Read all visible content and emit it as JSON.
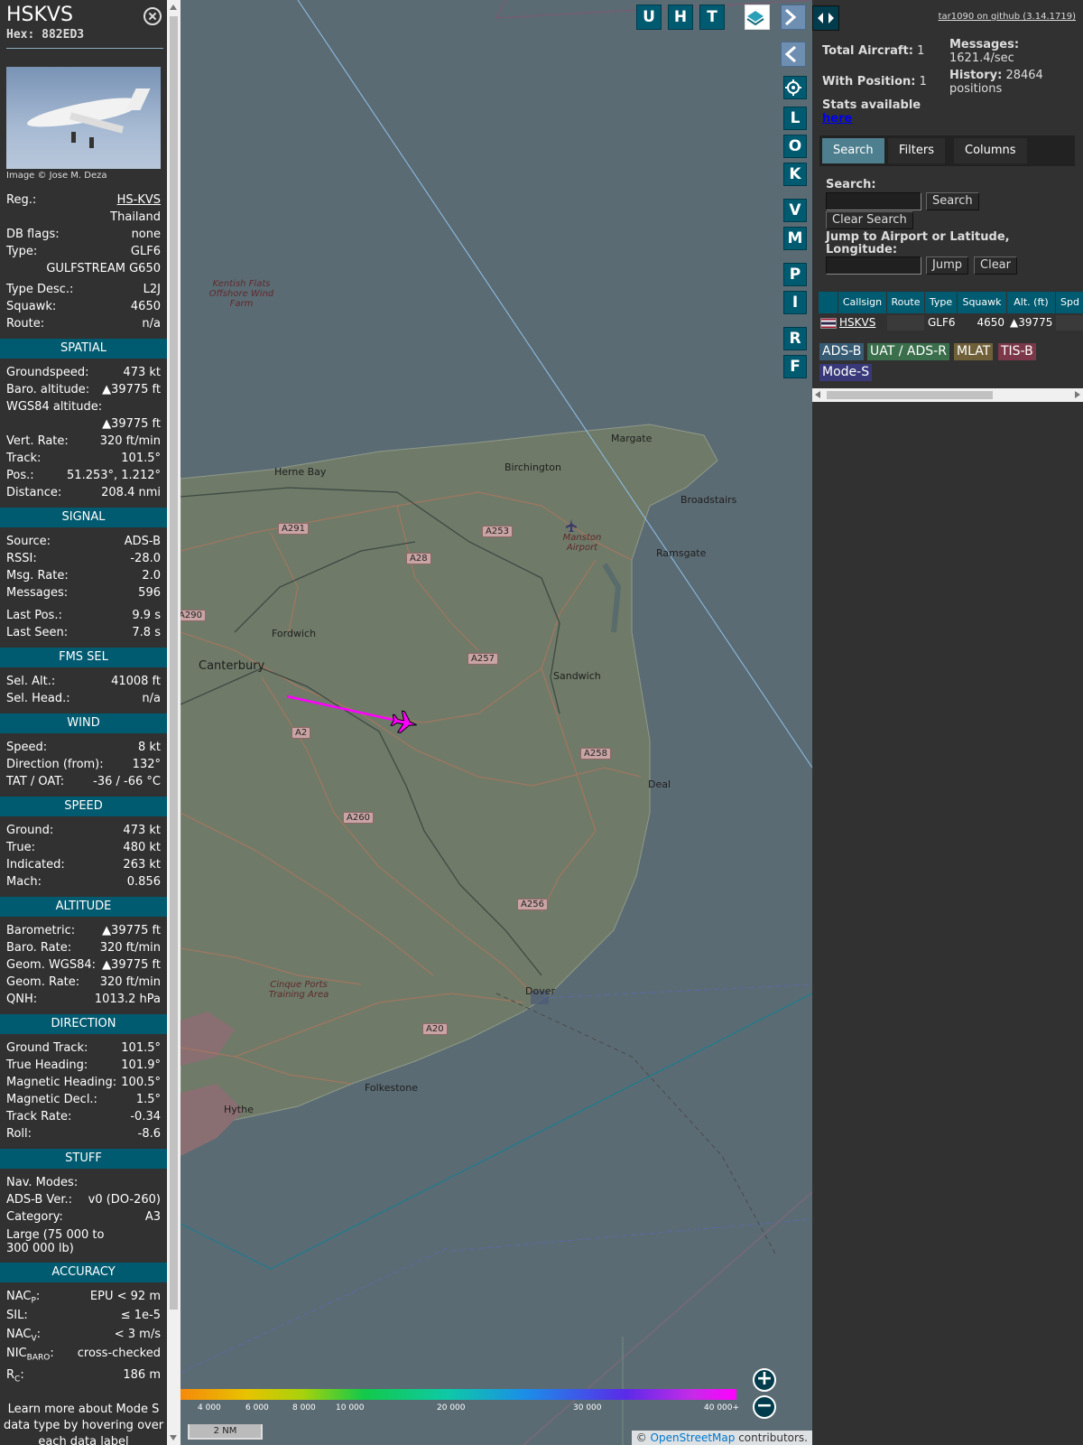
{
  "aircraft": {
    "callsign": "HSKVS",
    "hex_label": "Hex:",
    "hex": "882ED3",
    "image_credit": "Image © Jose M. Deza"
  },
  "details": {
    "reg_label": "Reg.:",
    "reg": "HS-KVS",
    "country": "Thailand",
    "dbflags_label": "DB flags:",
    "dbflags": "none",
    "type_label": "Type:",
    "type": "GLF6",
    "type_name": "GULFSTREAM G650",
    "typedesc_label": "Type Desc.:",
    "typedesc": "L2J",
    "squawk_label": "Squawk:",
    "squawk": "4650",
    "route_label": "Route:",
    "route": "n/a"
  },
  "spatial": {
    "title": "SPATIAL",
    "groundspeed_label": "Groundspeed:",
    "groundspeed": "473 kt",
    "baro_label": "Baro. altitude:",
    "baro": "▲39775 ft",
    "wgs_label": "WGS84 altitude:",
    "wgs": "▲39775 ft",
    "vrate_label": "Vert. Rate:",
    "vrate": "320 ft/min",
    "track_label": "Track:",
    "track": "101.5°",
    "pos_label": "Pos.:",
    "pos": "51.253°, 1.212°",
    "dist_label": "Distance:",
    "dist": "208.4 nmi"
  },
  "signal": {
    "title": "SIGNAL",
    "source_label": "Source:",
    "source": "ADS-B",
    "rssi_label": "RSSI:",
    "rssi": "-28.0",
    "msgrate_label": "Msg. Rate:",
    "msgrate": "2.0",
    "messages_label": "Messages:",
    "messages": "596",
    "lastpos_label": "Last Pos.:",
    "lastpos": "9.9 s",
    "lastseen_label": "Last Seen:",
    "lastseen": "7.8 s"
  },
  "fms": {
    "title": "FMS SEL",
    "selalt_label": "Sel. Alt.:",
    "selalt": "41008 ft",
    "selhead_label": "Sel. Head.:",
    "selhead": "n/a"
  },
  "wind": {
    "title": "WIND",
    "speed_label": "Speed:",
    "speed": "8 kt",
    "dir_label": "Direction (from):",
    "dir": "132°",
    "tat_label": "TAT / OAT:",
    "tat": "-36 / -66 °C"
  },
  "speed": {
    "title": "SPEED",
    "ground_label": "Ground:",
    "ground": "473 kt",
    "true_label": "True:",
    "true": "480 kt",
    "ind_label": "Indicated:",
    "ind": "263 kt",
    "mach_label": "Mach:",
    "mach": "0.856"
  },
  "altitude": {
    "title": "ALTITUDE",
    "baro_label": "Barometric:",
    "baro": "▲39775 ft",
    "barorate_label": "Baro. Rate:",
    "barorate": "320 ft/min",
    "geom_label": "Geom. WGS84:",
    "geom": "▲39775 ft",
    "geomrate_label": "Geom. Rate:",
    "geomrate": "320 ft/min",
    "qnh_label": "QNH:",
    "qnh": "1013.2 hPa"
  },
  "direction": {
    "title": "DIRECTION",
    "gtrack_label": "Ground Track:",
    "gtrack": "101.5°",
    "thead_label": "True Heading:",
    "thead": "101.9°",
    "mhead_label": "Magnetic Heading:",
    "mhead": "100.5°",
    "mdecl_label": "Magnetic Decl.:",
    "mdecl": "1.5°",
    "trate_label": "Track Rate:",
    "trate": "-0.34",
    "roll_label": "Roll:",
    "roll": "-8.6"
  },
  "stuff": {
    "title": "STUFF",
    "nav_label": "Nav. Modes:",
    "nav": "",
    "adsbver_label": "ADS-B Ver.:",
    "adsbver": "v0 (DO-260)",
    "cat_label": "Category:",
    "cat": "A3",
    "cat_desc": "Large (75 000 to 300 000 lb)"
  },
  "accuracy": {
    "title": "ACCURACY",
    "nacp_label": "NAC",
    "nacp_sub": "P",
    "nacp": "EPU < 92 m",
    "sil_label": "SIL:",
    "sil": "≤ 1e-5",
    "nacv_label": "NAC",
    "nacv_sub": "V",
    "nacv": "< 3 m/s",
    "nicbaro_label": "NIC",
    "nicbaro_sub": "BARO",
    "nicbaro": "cross-checked",
    "rc_label": "R",
    "rc_sub": "C",
    "rc": "186 m"
  },
  "footnote": "Learn more about Mode S data type by hovering over each data label",
  "map": {
    "places": {
      "margate": "Margate",
      "birchington": "Birchington",
      "hernebay": "Herne Bay",
      "broadstairs": "Broadstairs",
      "ramsgate": "Ramsgate",
      "manston": "Manston Airport",
      "fordwich": "Fordwich",
      "canterbury": "Canterbury",
      "sandwich": "Sandwich",
      "deal": "Deal",
      "dover": "Dover",
      "folkestone": "Folkestone",
      "hythe": "Hythe",
      "kentish": "Kentish Flats Offshore Wind Farm",
      "cinque": "Cinque Ports Training Area"
    },
    "roads": {
      "a291": "A291",
      "a28": "A28",
      "a253": "A253",
      "a290": "A290",
      "a257": "A257",
      "a2": "A2",
      "a258": "A258",
      "a260": "A260",
      "a256": "A256",
      "a20": "A20"
    },
    "controls": [
      "U",
      "H",
      "T"
    ],
    "side_controls": [
      "L",
      "O",
      "K",
      "V",
      "M",
      "P",
      "I",
      "R",
      "F"
    ],
    "alt_ticks": [
      "4 000",
      "6 000",
      "8 000",
      "10 000",
      "20 000",
      "30 000",
      "40 000+"
    ],
    "scale": "2 NM",
    "attribution_prefix": "© ",
    "attribution_link": "OpenStreetMap",
    "attribution_suffix": " contributors."
  },
  "side": {
    "github": "tar1090 on github (3.14.1719)",
    "total_label": "Total Aircraft:",
    "total": "1",
    "withpos_label": "With Position:",
    "withpos": "1",
    "messages_label": "Messages:",
    "messages": "1621.4/sec",
    "history_label": "History:",
    "history": "28464 positions",
    "stats_label": "Stats available",
    "stats_link": "here",
    "tabs": [
      "Search",
      "Filters",
      "Columns"
    ],
    "search_label": "Search:",
    "search_button": "Search",
    "clear_search": "Clear Search",
    "jump_label": "Jump to Airport or Latitude, Longitude:",
    "jump_button": "Jump",
    "clear_button": "Clear",
    "columns": [
      "Callsign",
      "Route",
      "Type",
      "Squawk",
      "Alt. (ft)",
      "Spd"
    ],
    "row": {
      "callsign": "HSKVS",
      "route": "",
      "type": "GLF6",
      "squawk": "4650",
      "alt": "▲39775"
    },
    "legend": [
      {
        "label": "ADS-B",
        "color": "#385b74"
      },
      {
        "label": "UAT / ADS-R",
        "color": "#3b6e4b"
      },
      {
        "label": "MLAT",
        "color": "#70603a"
      },
      {
        "label": "TIS-B",
        "color": "#7a3848"
      },
      {
        "label": "Mode-S",
        "color": "#39397a"
      }
    ]
  },
  "colors": {
    "accent": "#005a70",
    "track": "#ff00ff",
    "panel": "#313131"
  }
}
